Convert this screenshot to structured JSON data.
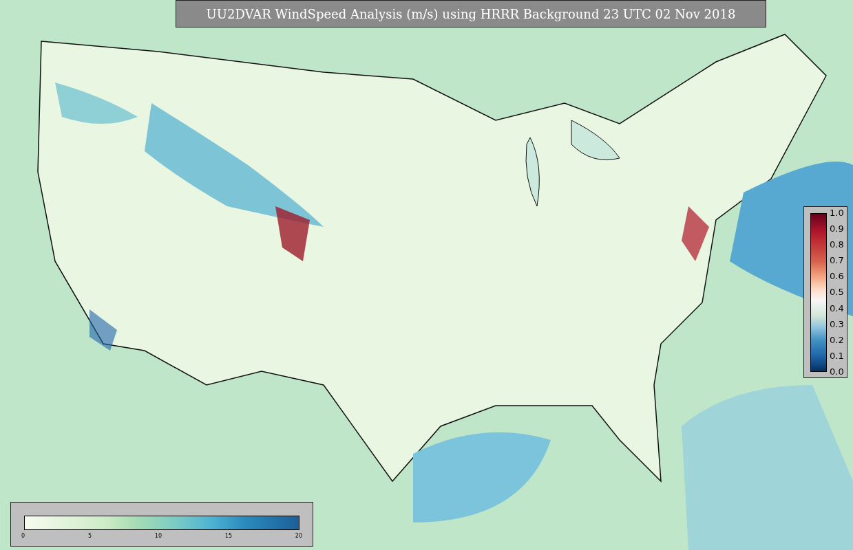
{
  "title": "UU2DVAR WindSpeed Analysis (m/s) using HRRR Background 23 UTC 02 Nov 2018",
  "ratio_colorbar": {
    "ticks": [
      "1.0",
      "0.9",
      "0.8",
      "0.7",
      "0.6",
      "0.5",
      "0.4",
      "0.3",
      "0.2",
      "0.1",
      "0.0"
    ]
  },
  "wind_colorbar": {
    "ticks": [
      "0",
      "5",
      "10",
      "15",
      "20"
    ]
  }
}
